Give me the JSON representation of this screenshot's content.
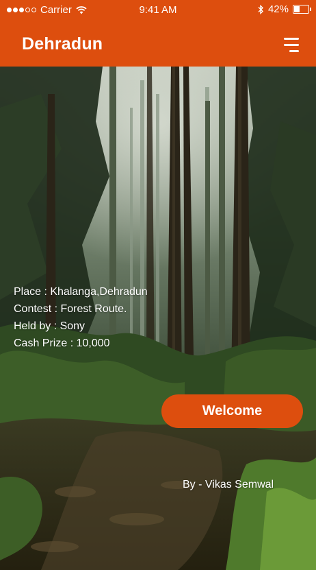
{
  "status_bar": {
    "carrier": "Carrier",
    "time": "9:41 AM",
    "battery": "42%",
    "battery_level": 0.42,
    "icons": [
      "signal-dots-icon",
      "wifi-icon",
      "bluetooth-icon",
      "battery-icon"
    ]
  },
  "header": {
    "title": "Dehradun",
    "menu_icon": "hamburger-menu-icon"
  },
  "details": {
    "place": "Place : Khalanga,Dehradun",
    "contest": "Contest : Forest Route.",
    "held_by": "Held by : Sony",
    "cash_prize": "Cash Prize : 10,000"
  },
  "actions": {
    "welcome_label": "Welcome"
  },
  "credit": "By - Vikas Semwal",
  "colors": {
    "accent": "#dd4e0e",
    "text_light": "#ffffff"
  }
}
